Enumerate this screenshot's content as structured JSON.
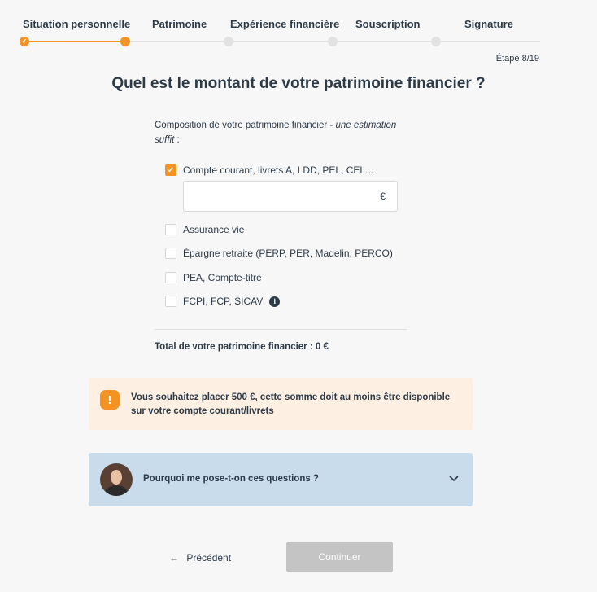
{
  "stepper": {
    "steps": [
      {
        "label": "Situation personnelle",
        "status": "done"
      },
      {
        "label": "Patrimoine",
        "status": "current"
      },
      {
        "label": "Expérience financière",
        "status": "todo"
      },
      {
        "label": "Souscription",
        "status": "todo"
      },
      {
        "label": "Signature",
        "status": "todo"
      }
    ],
    "counter": "Étape 8/19"
  },
  "page": {
    "title": "Quel est le montant de votre patrimoine financier ?"
  },
  "form": {
    "intro_prefix": "Composition de votre patrimoine financier - ",
    "intro_italic": "une estimation suffit",
    "intro_suffix": " :",
    "options": [
      {
        "label": "Compte courant, livrets A, LDD, PEL, CEL...",
        "checked": true
      },
      {
        "label": "Assurance vie",
        "checked": false
      },
      {
        "label": "Épargne retraite (PERP, PER, Madelin, PERCO)",
        "checked": false
      },
      {
        "label": "PEA, Compte-titre",
        "checked": false
      },
      {
        "label": "FCPI, FCP, SICAV",
        "checked": false,
        "info_icon": "info-icon"
      }
    ],
    "amount_value": "",
    "currency": "€",
    "total_label": "Total de votre patrimoine financier : 0 €"
  },
  "warning": {
    "icon": "warning-icon",
    "text": "Vous souhaitez placer 500 €, cette somme doit au moins être disponible sur votre compte courant/livrets"
  },
  "faq": {
    "question": "Pourquoi me pose-t-on ces questions ?",
    "icon": "chevron-down-icon"
  },
  "nav": {
    "prev_arrow": "←",
    "prev_label": "Précédent",
    "continue_label": "Continuer"
  },
  "colors": {
    "accent": "#f39323",
    "text": "#2d3a48",
    "warning_bg": "#fdefe2",
    "faq_bg": "#c9dcec",
    "disabled_button": "#c4c4c4"
  }
}
